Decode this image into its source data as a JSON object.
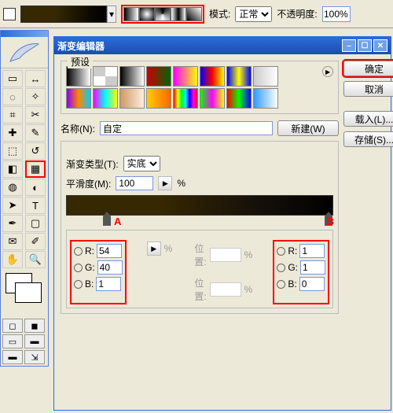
{
  "optbar": {
    "mode_label": "模式:",
    "mode_value": "正常",
    "opacity_label": "不透明度:",
    "opacity_value": "100%"
  },
  "dialog": {
    "title": "渐变编辑器",
    "presets_label": "预设",
    "ok": "确定",
    "cancel": "取消",
    "load": "载入(L)...",
    "save": "存储(S)...",
    "name_label": "名称(N):",
    "name_value": "自定",
    "new_btn": "新建(W)",
    "type_label": "渐变类型(T):",
    "type_value": "实底",
    "smooth_label": "平滑度(M):",
    "smooth_value": "100",
    "percent": "%",
    "marker_a": "A",
    "marker_b": "B",
    "pos_label": "位置:",
    "rgb_a": {
      "r_label": "R:",
      "r": "54",
      "g_label": "G:",
      "g": "40",
      "b_label": "B:",
      "b": "1"
    },
    "rgb_b": {
      "r_label": "R:",
      "r": "1",
      "g_label": "G:",
      "g": "1",
      "b_label": "B:",
      "b": "0"
    }
  },
  "preset_gradients": [
    "linear-gradient(to right,#000,#fff)",
    "repeating-conic-gradient(#fff 0 25%,#ccc 0 50%)",
    "linear-gradient(to right,#000,#fff)",
    "linear-gradient(to right,#c00,#060)",
    "linear-gradient(to right,#f0f,#ff0)",
    "linear-gradient(to right,#00f,#f00,#ff0)",
    "linear-gradient(to right,#00f,#ff0,#00f)",
    "linear-gradient(to right,#ccc,#fff)",
    "linear-gradient(to right,#80f,#f80,#0cf)",
    "linear-gradient(to right,#f0f,#0ff,#ff0)",
    "linear-gradient(to right,#c96,#fed)",
    "linear-gradient(to right,#fc0,#f60)",
    "linear-gradient(to right,#f00,#ff0,#0f0,#0ff,#00f,#f0f,#f00)",
    "linear-gradient(to right,#0f0,#f0f,#ff0)",
    "linear-gradient(to right,#f00,#0f0,#00f)",
    "linear-gradient(to right,#39f,#fff)"
  ]
}
